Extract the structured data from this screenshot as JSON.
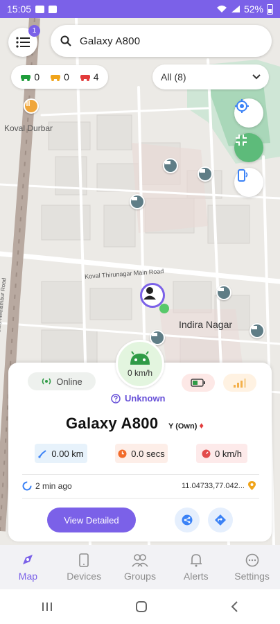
{
  "status_bar": {
    "time": "15:05",
    "battery": "52%"
  },
  "search": {
    "value": "Galaxy A800"
  },
  "menu": {
    "badge": "1"
  },
  "counters": [
    {
      "value": "0",
      "color": "#1f9d3b"
    },
    {
      "value": "0",
      "color": "#f0a41a"
    },
    {
      "value": "4",
      "color": "#e23b3b"
    }
  ],
  "filter": {
    "selected": "All (8)"
  },
  "map_labels": {
    "place1": "Koval Durbar",
    "road1": "Koval Thirunagar Main Road",
    "area1": "Indira Nagar",
    "road_vert": "Sitra-Neelambur Road"
  },
  "card": {
    "speed": "0 km/h",
    "status": "Online",
    "location_state": "Unknown",
    "device_name": "Galaxy A800",
    "owner": "Y (Own)",
    "distance": "0.00 km",
    "duration": "0.0 secs",
    "max_speed": "0 km/h",
    "updated": "2 min ago",
    "coords": "11.04733,77.042...",
    "view_button": "View Detailed"
  },
  "nav": [
    {
      "label": "Map",
      "icon": "map-icon"
    },
    {
      "label": "Devices",
      "icon": "phone-icon"
    },
    {
      "label": "Groups",
      "icon": "group-icon"
    },
    {
      "label": "Alerts",
      "icon": "bell-icon"
    },
    {
      "label": "Settings",
      "icon": "settings-icon"
    }
  ],
  "colors": {
    "accent": "#7b61e8",
    "online": "#2f9b46",
    "map_bg": "#eceae6"
  }
}
